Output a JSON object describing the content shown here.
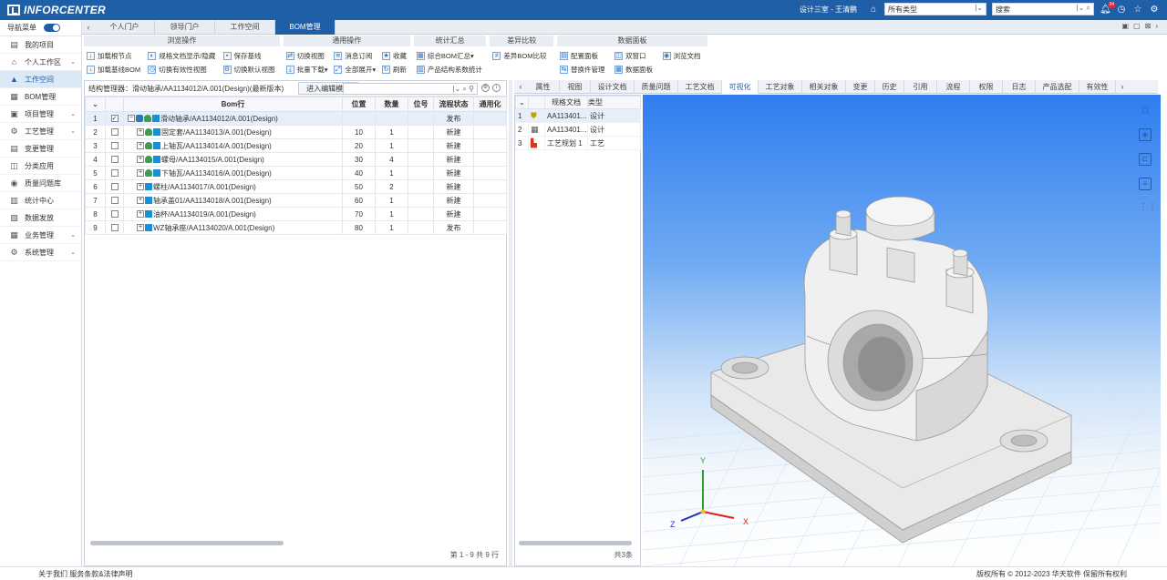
{
  "header": {
    "logo": "INFORCENTER",
    "user": "设计三室 - 王清鹏",
    "type_select": "所有类型",
    "search_placeholder": "搜索",
    "notif_count": "34"
  },
  "sidebar": {
    "nav_label": "导航菜单",
    "items": [
      "我的项目",
      "个人工作区",
      "工作空间",
      "BOM管理",
      "项目管理",
      "工艺管理",
      "变更管理",
      "分类应用",
      "质量问题库",
      "统计中心",
      "数据发放",
      "业务管理",
      "系统管理"
    ]
  },
  "tabs": [
    "个人门户",
    "领导门户",
    "工作空间",
    "BOM管理"
  ],
  "ribbon": {
    "browse": {
      "title": "浏览操作",
      "buttons": [
        "加载根节点",
        "加载基线BOM",
        "规格文档显示/隐藏",
        "切换有效性视图",
        "保存基线",
        "切换默认视图"
      ]
    },
    "common": {
      "title": "通用操作",
      "buttons": [
        "切换视图",
        "批量下载",
        "消息订阅",
        "全部展开",
        "收藏",
        "刷新"
      ]
    },
    "stats": {
      "title": "统计汇总",
      "buttons": [
        "综合BOM汇总",
        "产品结构系数统计"
      ]
    },
    "diff": {
      "title": "差异比较",
      "buttons": [
        "差异BOM比较"
      ]
    },
    "panel": {
      "title": "数据面板",
      "buttons": [
        "配置面板",
        "替换件管理",
        "双窗口",
        "数据面板",
        "浏览文档"
      ]
    }
  },
  "left": {
    "struct_label": "结构管理器：滑动轴承/AA1134012/A.001(Design)(最新版本)",
    "edit_mode": "进入编辑模式",
    "columns": [
      "Bom行",
      "位置",
      "数量",
      "位号",
      "流程状态",
      "通用化"
    ],
    "rows": [
      {
        "n": "1",
        "name": "滑动轴承/AA1134012/A.001(Design)",
        "pos": "",
        "qty": "",
        "tag": "",
        "status": "发布"
      },
      {
        "n": "2",
        "name": "固定套/AA1134013/A.001(Design)",
        "pos": "10",
        "qty": "1",
        "tag": "",
        "status": "新建"
      },
      {
        "n": "3",
        "name": "上轴瓦/AA1134014/A.001(Design)",
        "pos": "20",
        "qty": "1",
        "tag": "",
        "status": "新建"
      },
      {
        "n": "4",
        "name": "螺母/AA1134015/A.001(Design)",
        "pos": "30",
        "qty": "4",
        "tag": "",
        "status": "新建"
      },
      {
        "n": "5",
        "name": "下轴瓦/AA1134016/A.001(Design)",
        "pos": "40",
        "qty": "1",
        "tag": "",
        "status": "新建"
      },
      {
        "n": "6",
        "name": "螺柱/AA1134017/A.001(Design)",
        "pos": "50",
        "qty": "2",
        "tag": "",
        "status": "新建"
      },
      {
        "n": "7",
        "name": "轴承盖01/AA1134018/A.001(Design)",
        "pos": "60",
        "qty": "1",
        "tag": "",
        "status": "新建"
      },
      {
        "n": "8",
        "name": "油杯/AA1134019/A.001(Design)",
        "pos": "70",
        "qty": "1",
        "tag": "",
        "status": "新建"
      },
      {
        "n": "9",
        "name": "WZ轴承座/AA1134020/A.001(Design)",
        "pos": "80",
        "qty": "1",
        "tag": "",
        "status": "发布"
      }
    ],
    "footer": "第 1 - 9 共 9 行"
  },
  "midtabs": [
    "属性",
    "视图",
    "设计文档",
    "质量问题",
    "工艺文档",
    "可视化",
    "工艺对象",
    "相关对象",
    "变更",
    "历史",
    "引用",
    "流程",
    "权限",
    "日志",
    "产品选配",
    "有效性"
  ],
  "docs": {
    "columns": [
      "规格文档",
      "类型"
    ],
    "rows": [
      {
        "n": "1",
        "name": "AA113401...",
        "type": "设计"
      },
      {
        "n": "2",
        "name": "AA113401...",
        "type": "设计"
      },
      {
        "n": "3",
        "name": "工艺规划 1",
        "type": "工艺"
      }
    ],
    "footer": "共3条"
  },
  "axes": {
    "x": "X",
    "y": "Y",
    "z": "Z"
  },
  "footer": {
    "left": "关于我们 服务条款&法律声明",
    "right": "版权所有 © 2012-2023 华天软件 保留所有权利"
  }
}
